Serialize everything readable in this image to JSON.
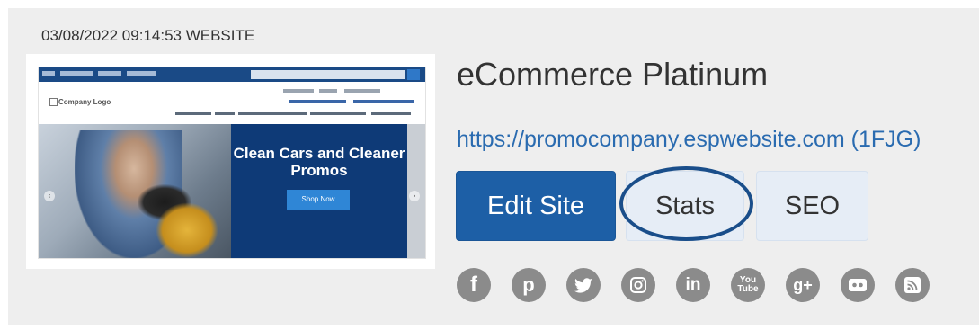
{
  "card": {
    "timestamp": "03/08/2022 09:14:53 WEBSITE",
    "site_name": "eCommerce Platinum",
    "site_url": "https://promocompany.espwebsite.com (1FJG)"
  },
  "thumbnail": {
    "logo_text": "Company Logo",
    "hero_title": "Clean Cars and Cleaner Promos",
    "hero_button": "Shop Now"
  },
  "actions": {
    "edit_label": "Edit Site",
    "stats_label": "Stats",
    "seo_label": "SEO"
  },
  "social_icons": [
    "facebook-icon",
    "pinterest-icon",
    "twitter-icon",
    "instagram-icon",
    "linkedin-icon",
    "youtube-icon",
    "google-plus-icon",
    "flickr-icon",
    "rss-icon"
  ],
  "colors": {
    "primary": "#1d5fa6",
    "link": "#2a6bb0",
    "highlight": "#1a4e8a",
    "icon_gray": "#8b8b8b"
  }
}
